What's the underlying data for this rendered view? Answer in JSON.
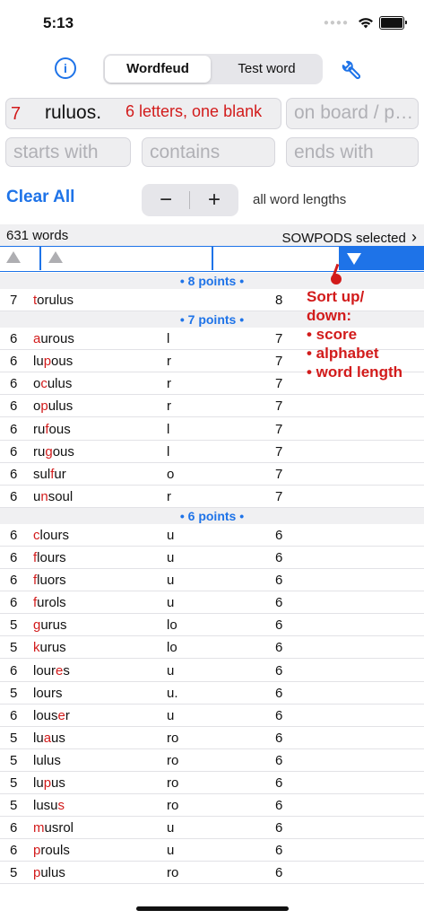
{
  "status": {
    "time": "5:13"
  },
  "header": {
    "tabs": [
      {
        "label": "Wordfeud"
      },
      {
        "label": "Test word"
      }
    ],
    "info_icon": "info-circle-icon",
    "settings_icon": "wrench-icon",
    "accent": "#1e73e8"
  },
  "search": {
    "letters_count": "7",
    "letters_value": "ruluos.",
    "letters_hint": "6 letters, one blank",
    "board_placeholder": "on board / p…",
    "starts_placeholder": "starts with",
    "contains_placeholder": "contains",
    "ends_placeholder": "ends with"
  },
  "controls": {
    "clear_all": "Clear All",
    "minus": "−",
    "plus": "+",
    "lengths_label": "all word lengths"
  },
  "results": {
    "count": "631 words",
    "dictionary": "SOWPODS selected",
    "chevron": "›",
    "groups": [
      {
        "header": "• 8 points •",
        "rows": [
          {
            "score": "7",
            "parts": [
              "",
              "t",
              "orulus"
            ],
            "used": "",
            "len": "8"
          }
        ]
      },
      {
        "header": "• 7 points •",
        "rows": [
          {
            "score": "6",
            "parts": [
              "",
              "a",
              "urous"
            ],
            "used": "l",
            "len": "7"
          },
          {
            "score": "6",
            "parts": [
              "lu",
              "p",
              "ous"
            ],
            "used": "r",
            "len": "7"
          },
          {
            "score": "6",
            "parts": [
              "o",
              "c",
              "ulus"
            ],
            "used": "r",
            "len": "7"
          },
          {
            "score": "6",
            "parts": [
              "o",
              "p",
              "ulus"
            ],
            "used": "r",
            "len": "7"
          },
          {
            "score": "6",
            "parts": [
              "ru",
              "f",
              "ous"
            ],
            "used": "l",
            "len": "7"
          },
          {
            "score": "6",
            "parts": [
              "ru",
              "g",
              "ous"
            ],
            "used": "l",
            "len": "7"
          },
          {
            "score": "6",
            "parts": [
              "sul",
              "f",
              "ur"
            ],
            "used": "o",
            "len": "7"
          },
          {
            "score": "6",
            "parts": [
              "u",
              "n",
              "soul"
            ],
            "used": "r",
            "len": "7"
          }
        ]
      },
      {
        "header": "• 6 points •",
        "rows": [
          {
            "score": "6",
            "parts": [
              "",
              "c",
              "lours"
            ],
            "used": "u",
            "len": "6"
          },
          {
            "score": "6",
            "parts": [
              "",
              "f",
              "lours"
            ],
            "used": "u",
            "len": "6"
          },
          {
            "score": "6",
            "parts": [
              "",
              "f",
              "luors"
            ],
            "used": "u",
            "len": "6"
          },
          {
            "score": "6",
            "parts": [
              "",
              "f",
              "urols"
            ],
            "used": "u",
            "len": "6"
          },
          {
            "score": "5",
            "parts": [
              "",
              "g",
              "urus"
            ],
            "used": "lo",
            "len": "6"
          },
          {
            "score": "5",
            "parts": [
              "",
              "k",
              "urus"
            ],
            "used": "lo",
            "len": "6"
          },
          {
            "score": "6",
            "parts": [
              "lour",
              "e",
              "s"
            ],
            "used": "u",
            "len": "6"
          },
          {
            "score": "5",
            "parts": [
              "lours",
              "",
              ""
            ],
            "used": "u.",
            "len": "6"
          },
          {
            "score": "6",
            "parts": [
              "lous",
              "e",
              "r"
            ],
            "used": "u",
            "len": "6"
          },
          {
            "score": "5",
            "parts": [
              "lu",
              "a",
              "us"
            ],
            "used": "ro",
            "len": "6"
          },
          {
            "score": "5",
            "parts": [
              "lulus",
              "",
              ""
            ],
            "used": "ro",
            "len": "6"
          },
          {
            "score": "5",
            "parts": [
              "lu",
              "p",
              "us"
            ],
            "used": "ro",
            "len": "6"
          },
          {
            "score": "5",
            "parts": [
              "lusu",
              "s",
              ""
            ],
            "used": "ro",
            "len": "6"
          },
          {
            "score": "6",
            "parts": [
              "",
              "m",
              "usrol"
            ],
            "used": "u",
            "len": "6"
          },
          {
            "score": "6",
            "parts": [
              "",
              "p",
              "rouls"
            ],
            "used": "u",
            "len": "6"
          },
          {
            "score": "5",
            "parts": [
              "",
              "p",
              "ulus"
            ],
            "used": "ro",
            "len": "6"
          }
        ]
      }
    ]
  },
  "annotation": {
    "lines": [
      "Sort up/",
      "down:",
      "• score",
      "• alphabet",
      "• word length"
    ],
    "color": "#d21b1b"
  }
}
